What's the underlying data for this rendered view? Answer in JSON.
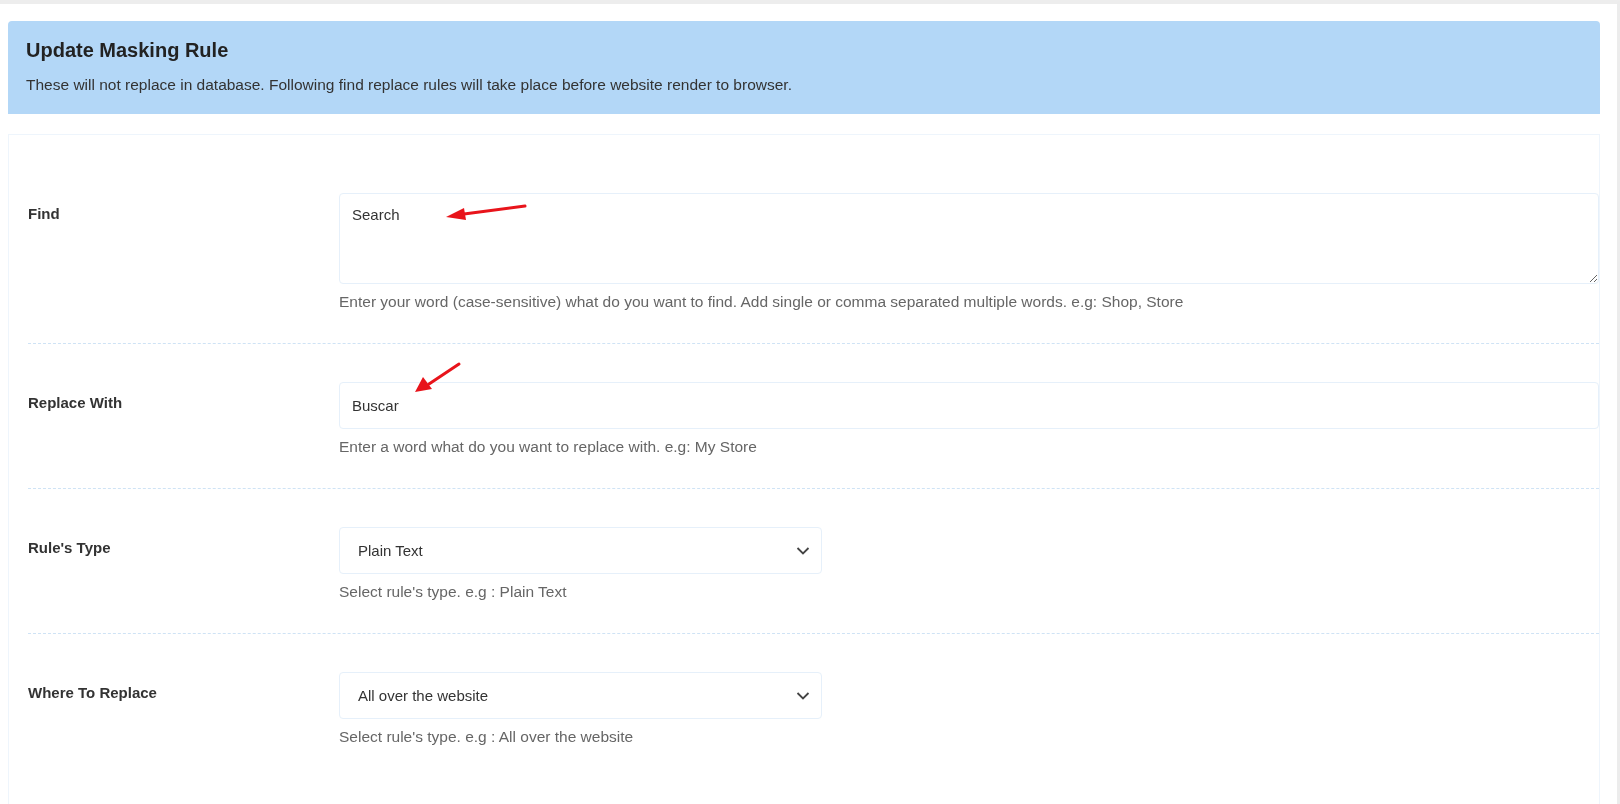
{
  "header": {
    "title": "Update Masking Rule",
    "description": "These will not replace in database. Following find replace rules will take place before website render to browser."
  },
  "fields": [
    {
      "kind": "textarea",
      "label": "Find",
      "value": "Search",
      "help": "Enter your word (case-sensitive) what do you want to find. Add single or comma separated multiple words. e.g: Shop, Store",
      "annotated": true
    },
    {
      "kind": "input",
      "label": "Replace With",
      "value": "Buscar",
      "help": "Enter a word what do you want to replace with. e.g: My Store",
      "annotated": true
    },
    {
      "kind": "select",
      "label": "Rule's Type",
      "value": "Plain Text",
      "help": "Select rule's type. e.g : Plain Text",
      "annotated": false
    },
    {
      "kind": "select",
      "label": "Where To Replace",
      "value": "All over the website",
      "help": "Select rule's type. e.g : All over the website",
      "annotated": false
    }
  ]
}
